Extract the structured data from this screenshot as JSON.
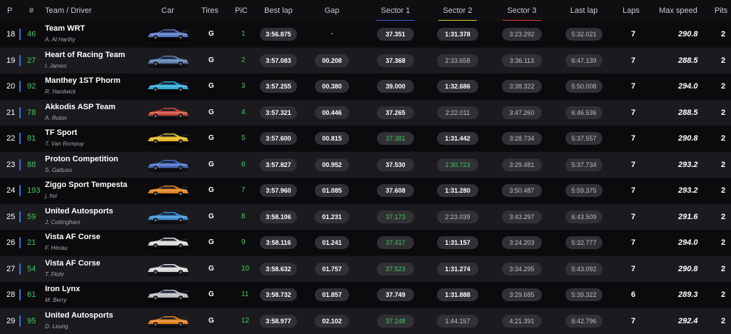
{
  "colors": {
    "green": "#3dcc5a",
    "sector1_underline": "#3b52d4",
    "sector2_underline": "#d6c238",
    "sector3_underline": "#d43b3b"
  },
  "header": {
    "position": "P",
    "number": "#",
    "team_driver": "Team / Driver",
    "car": "Car",
    "tires": "Tires",
    "pic": "PiC",
    "best_lap": "Best lap",
    "gap": "Gap",
    "sector1": "Sector 1",
    "sector2": "Sector 2",
    "sector3": "Sector 3",
    "last_lap": "Last lap",
    "laps": "Laps",
    "max_speed": "Max speed",
    "pits": "Pits"
  },
  "rows": [
    {
      "pos": "18",
      "bar": "#3b6fd6",
      "num": "46",
      "team": "Team WRT",
      "driver": "A. Al Harthy",
      "car_icon": "bmw-m4-gt3-blue-icon",
      "car_color": "#5677c2",
      "tire": "G",
      "pic": "1",
      "best": "3:56.875",
      "gap": "-",
      "s1": "37.351",
      "s1_state": "normal",
      "s2": "1:31.378",
      "s2_state": "normal",
      "s3": "3:23.292",
      "s3_state": "dim",
      "last": "5:32.021",
      "laps": "7",
      "speed": "290.8",
      "pits": "2"
    },
    {
      "pos": "19",
      "bar": "#3b6fd6",
      "num": "27",
      "team": "Heart of Racing Team",
      "driver": "I. James",
      "car_icon": "aston-martin-gt3-icon",
      "car_color": "#5b7fb0",
      "tire": "G",
      "pic": "2",
      "best": "3:57.083",
      "gap": "00.208",
      "s1": "37.368",
      "s1_state": "normal",
      "s2": "2:33.658",
      "s2_state": "dim",
      "s3": "3:36.113",
      "s3_state": "dim",
      "last": "6:47.139",
      "laps": "7",
      "speed": "288.5",
      "pits": "2"
    },
    {
      "pos": "20",
      "bar": "#3b6fd6",
      "num": "92",
      "team": "Manthey 1ST Phorm",
      "driver": "R. Hardwick",
      "car_icon": "porsche-911-gt3-r-icon",
      "car_color": "#2fa8d8",
      "tire": "G",
      "pic": "3",
      "best": "3:57.255",
      "gap": "00.380",
      "s1": "39.000",
      "s1_state": "normal",
      "s2": "1:32.686",
      "s2_state": "normal",
      "s3": "3:38.322",
      "s3_state": "dim",
      "last": "5:50.008",
      "laps": "7",
      "speed": "294.0",
      "pits": "2"
    },
    {
      "pos": "21",
      "bar": "#3b6fd6",
      "num": "78",
      "team": "Akkodis ASP Team",
      "driver": "A. Robin",
      "car_icon": "lexus-rc-f-gt3-icon",
      "car_color": "#c94a3a",
      "tire": "G",
      "pic": "4",
      "best": "3:57.321",
      "gap": "00.446",
      "s1": "37.265",
      "s1_state": "normal",
      "s2": "2:22.011",
      "s2_state": "dim",
      "s3": "3:47.260",
      "s3_state": "dim",
      "last": "6:46.536",
      "laps": "7",
      "speed": "288.5",
      "pits": "2"
    },
    {
      "pos": "22",
      "bar": "#3b6fd6",
      "num": "81",
      "team": "TF Sport",
      "driver": "T. Van Rompuy",
      "car_icon": "corvette-z06-gt3-icon",
      "car_color": "#e3b521",
      "tire": "G",
      "pic": "5",
      "best": "3:57.600",
      "gap": "00.815",
      "s1": "37.381",
      "s1_state": "green",
      "s2": "1:31.442",
      "s2_state": "normal",
      "s3": "3:28.734",
      "s3_state": "dim",
      "last": "5:37.557",
      "laps": "7",
      "speed": "290.8",
      "pits": "2"
    },
    {
      "pos": "23",
      "bar": "#3b6fd6",
      "num": "88",
      "team": "Proton Competition",
      "driver": "S. Gattuso",
      "car_icon": "ford-mustang-gt3-icon",
      "car_color": "#4a6cc4",
      "tire": "G",
      "pic": "6",
      "best": "3:57.827",
      "gap": "00.952",
      "s1": "37.530",
      "s1_state": "normal",
      "s2": "1:30.723",
      "s2_state": "green",
      "s3": "3:29.481",
      "s3_state": "dim",
      "last": "5:37.734",
      "laps": "7",
      "speed": "293.2",
      "pits": "2"
    },
    {
      "pos": "24",
      "bar": "#3b6fd6",
      "num": "193",
      "team": "Ziggo Sport Tempesta",
      "driver": "j. hui",
      "car_icon": "mclaren-720s-gt3-icon",
      "car_color": "#e0801e",
      "tire": "G",
      "pic": "7",
      "best": "3:57.960",
      "gap": "01.085",
      "s1": "37.608",
      "s1_state": "normal",
      "s2": "1:31.280",
      "s2_state": "normal",
      "s3": "3:50.487",
      "s3_state": "dim",
      "last": "5:59.375",
      "laps": "7",
      "speed": "293.2",
      "pits": "2"
    },
    {
      "pos": "25",
      "bar": "#3b6fd6",
      "num": "59",
      "team": "United Autosports",
      "driver": "J. Cottingham",
      "car_icon": "mclaren-720s-gt3-icon",
      "car_color": "#3a8fd6",
      "tire": "G",
      "pic": "8",
      "best": "3:58.106",
      "gap": "01.231",
      "s1": "37.173",
      "s1_state": "green",
      "s2": "2:23.039",
      "s2_state": "dim",
      "s3": "3:43.297",
      "s3_state": "dim",
      "last": "6:43.509",
      "laps": "7",
      "speed": "291.6",
      "pits": "2"
    },
    {
      "pos": "26",
      "bar": "#3b6fd6",
      "num": "21",
      "team": "Vista AF Corse",
      "driver": "F. Hériau",
      "car_icon": "ferrari-296-gt3-icon",
      "car_color": "#d8d8d8",
      "tire": "G",
      "pic": "9",
      "best": "3:58.116",
      "gap": "01.241",
      "s1": "37.417",
      "s1_state": "green",
      "s2": "1:31.157",
      "s2_state": "normal",
      "s3": "3:24.203",
      "s3_state": "dim",
      "last": "5:32.777",
      "laps": "7",
      "speed": "294.0",
      "pits": "2"
    },
    {
      "pos": "27",
      "bar": "#3b6fd6",
      "num": "54",
      "team": "Vista AF Corse",
      "driver": "T. Flohr",
      "car_icon": "ferrari-296-gt3-icon",
      "car_color": "#d8d8d8",
      "tire": "G",
      "pic": "10",
      "best": "3:58.632",
      "gap": "01.757",
      "s1": "37.523",
      "s1_state": "green",
      "s2": "1:31.274",
      "s2_state": "normal",
      "s3": "3:34.295",
      "s3_state": "dim",
      "last": "5:43.092",
      "laps": "7",
      "speed": "290.8",
      "pits": "2"
    },
    {
      "pos": "28",
      "bar": "#3b6fd6",
      "num": "61",
      "team": "Iron Lynx",
      "driver": "M. Berry",
      "car_icon": "lamborghini-huracan-gt3-icon",
      "car_color": "#b9bcc4",
      "tire": "G",
      "pic": "11",
      "best": "3:58.732",
      "gap": "01.857",
      "s1": "37.749",
      "s1_state": "normal",
      "s2": "1:31.888",
      "s2_state": "normal",
      "s3": "3:29.685",
      "s3_state": "dim",
      "last": "5:39.322",
      "laps": "6",
      "speed": "289.3",
      "pits": "2"
    },
    {
      "pos": "29",
      "bar": "#3b6fd6",
      "num": "95",
      "team": "United Autosports",
      "driver": "D. Leung",
      "car_icon": "mclaren-720s-gt3-icon",
      "car_color": "#e0801e",
      "tire": "G",
      "pic": "12",
      "best": "3:58.977",
      "gap": "02.102",
      "s1": "37.248",
      "s1_state": "green",
      "s2": "1:44.157",
      "s2_state": "dim",
      "s3": "4:21.391",
      "s3_state": "dim",
      "last": "6:42.796",
      "laps": "7",
      "speed": "292.4",
      "pits": "2"
    }
  ]
}
